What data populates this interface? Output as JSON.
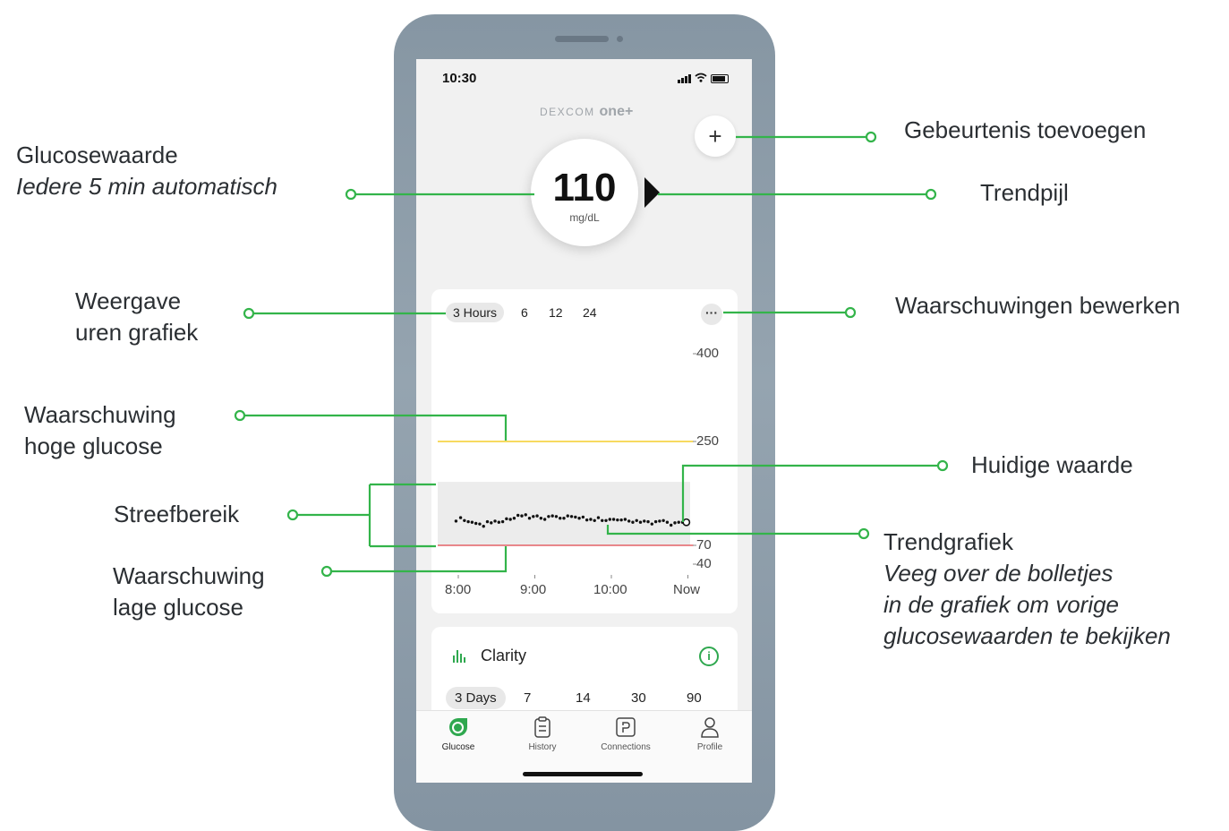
{
  "annotations": {
    "glucose_value": {
      "title": "Glucosewaarde",
      "subtitle": "Iedere 5 min automatisch"
    },
    "add_event": "Gebeurtenis toevoegen",
    "trend_arrow": "Trendpijl",
    "hours_view": {
      "line1": "Weergave",
      "line2": "uren grafiek"
    },
    "edit_alerts": "Waarschuwingen bewerken",
    "high_alert": {
      "line1": "Waarschuwing",
      "line2": "hoge glucose"
    },
    "current_value": "Huidige waarde",
    "target_range": "Streefbereik",
    "trend_graph": {
      "title": "Trendgrafiek",
      "line1": "Veeg over de bolletjes",
      "line2": "in de grafiek om vorige",
      "line3": "glucosewaarden te bekijken"
    },
    "low_alert": {
      "line1": "Waarschuwing",
      "line2": "lage glucose"
    }
  },
  "status_bar": {
    "time": "10:30"
  },
  "header": {
    "logo_prefix": "DEXCOM",
    "logo_brand": "one+",
    "add_button": "+"
  },
  "glucose": {
    "value": "110",
    "unit": "mg/dL",
    "trend": "right-arrow"
  },
  "chart_card": {
    "ranges": [
      {
        "label": "3 Hours",
        "active": true
      },
      {
        "label": "6",
        "active": false
      },
      {
        "label": "12",
        "active": false
      },
      {
        "label": "24",
        "active": false
      }
    ],
    "more_button": "···"
  },
  "chart_data": {
    "type": "scatter",
    "x_ticks": [
      "8:00",
      "9:00",
      "10:00",
      "Now"
    ],
    "y_ticks": [
      "400",
      "250",
      "70",
      "40"
    ],
    "ylim": [
      40,
      400
    ],
    "high_alert": 250,
    "low_alert": 70,
    "target_range": [
      70,
      180
    ],
    "x": [
      7.97,
      8.03,
      8.08,
      8.13,
      8.18,
      8.23,
      8.28,
      8.33,
      8.38,
      8.43,
      8.48,
      8.53,
      8.58,
      8.63,
      8.68,
      8.73,
      8.78,
      8.83,
      8.88,
      8.93,
      8.98,
      9.03,
      9.08,
      9.13,
      9.18,
      9.23,
      9.28,
      9.33,
      9.38,
      9.43,
      9.48,
      9.53,
      9.58,
      9.63,
      9.68,
      9.73,
      9.78,
      9.83,
      9.88,
      9.93,
      9.98,
      10.03,
      10.08,
      10.13,
      10.18,
      10.23,
      10.28,
      10.33,
      10.38,
      10.43,
      10.48,
      10.53,
      10.58,
      10.63,
      10.68,
      10.73,
      10.78,
      10.83,
      10.88,
      10.93,
      10.98
    ],
    "values": [
      112,
      118,
      113,
      111,
      110,
      108,
      107,
      103,
      111,
      109,
      112,
      110,
      111,
      116,
      115,
      117,
      122,
      121,
      123,
      117,
      120,
      121,
      117,
      115,
      120,
      121,
      120,
      117,
      117,
      121,
      120,
      119,
      117,
      119,
      114,
      115,
      113,
      118,
      113,
      113,
      115,
      115,
      114,
      114,
      115,
      112,
      110,
      113,
      110,
      112,
      111,
      107,
      111,
      112,
      113,
      110,
      105,
      109,
      110,
      110,
      110
    ],
    "current": 110
  },
  "clarity_card": {
    "title": "Clarity",
    "ranges": [
      {
        "label": "3 Days",
        "active": true
      },
      {
        "label": "7",
        "active": false
      },
      {
        "label": "14",
        "active": false
      },
      {
        "label": "30",
        "active": false
      },
      {
        "label": "90",
        "active": false
      }
    ]
  },
  "tab_bar": [
    {
      "label": "Glucose",
      "icon": "glucose-icon",
      "active": true
    },
    {
      "label": "History",
      "icon": "clipboard-icon",
      "active": false
    },
    {
      "label": "Connections",
      "icon": "connections-icon",
      "active": false
    },
    {
      "label": "Profile",
      "icon": "profile-icon",
      "active": false
    }
  ],
  "colors": {
    "accent": "#2fa84f",
    "high_alert": "#f2c300",
    "low_alert": "#e0444a",
    "target_band": "#ececec",
    "leader": "#33b44a"
  }
}
